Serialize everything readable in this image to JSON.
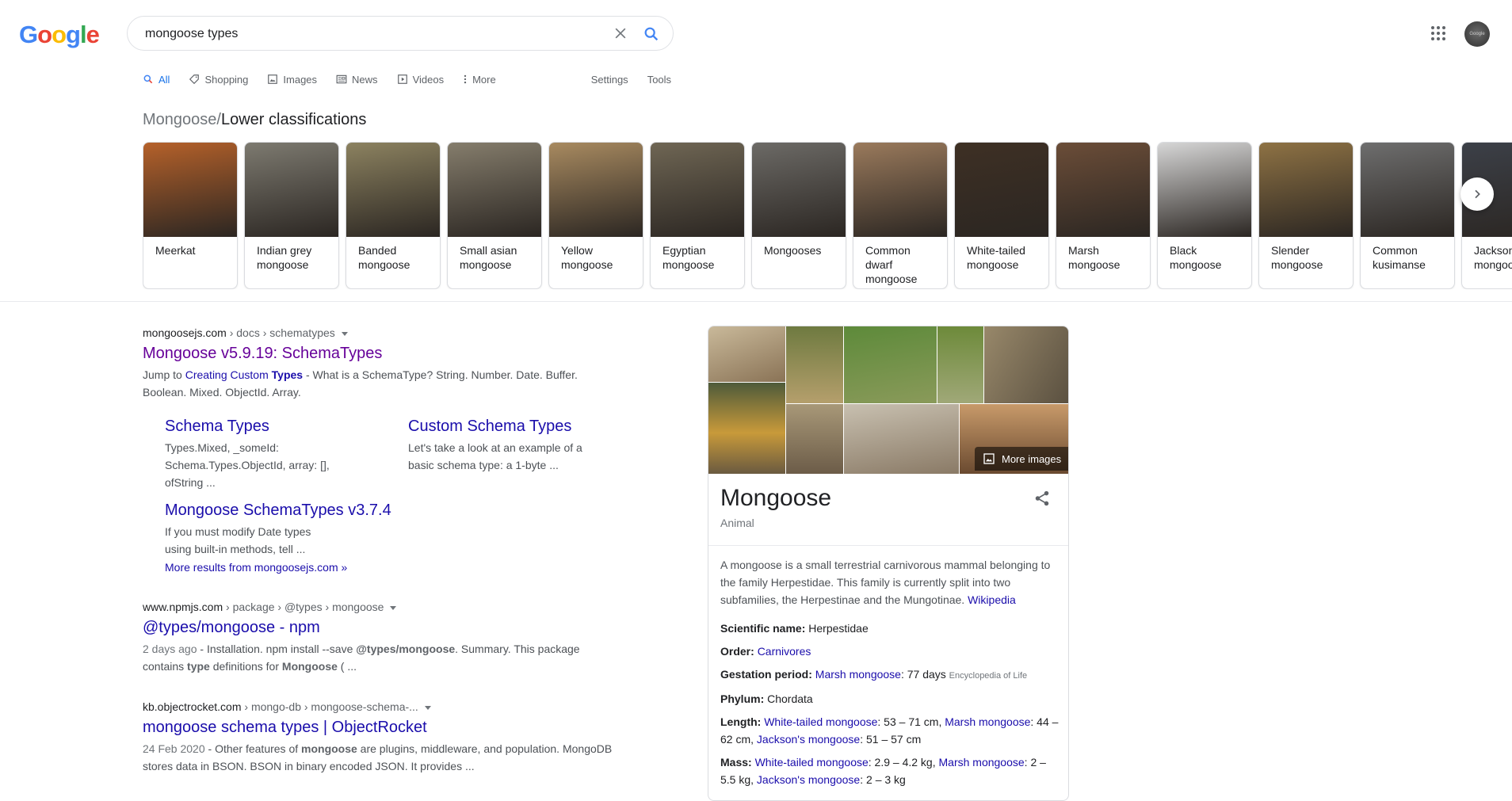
{
  "header": {
    "logo_text": "Google",
    "search_value": "mongoose types",
    "avatar_text": "Google"
  },
  "tabs": [
    {
      "label": "All",
      "icon": "search-icon",
      "active": true
    },
    {
      "label": "Shopping",
      "icon": "tag-icon"
    },
    {
      "label": "Images",
      "icon": "image-icon"
    },
    {
      "label": "News",
      "icon": "news-icon"
    },
    {
      "label": "Videos",
      "icon": "video-icon"
    },
    {
      "label": "More",
      "icon": "more-vert-icon"
    }
  ],
  "tools": {
    "settings": "Settings",
    "tools": "Tools"
  },
  "carousel": {
    "parent": "Mongoose",
    "separator": "/",
    "title": "Lower classifications",
    "items": [
      {
        "label": "Meerkat",
        "color": "#b5612a"
      },
      {
        "label": "Indian grey mongoose",
        "color": "#7d7a70"
      },
      {
        "label": "Banded mongoose",
        "color": "#8c8260"
      },
      {
        "label": "Small asian mongoose",
        "color": "#857d6c"
      },
      {
        "label": "Yellow mongoose",
        "color": "#a88a60"
      },
      {
        "label": "Egyptian mongoose",
        "color": "#6f6654"
      },
      {
        "label": "Mongooses",
        "color": "#6c6a66"
      },
      {
        "label": "Common dwarf mongoose",
        "color": "#9a7a5c"
      },
      {
        "label": "White-tailed mongoose",
        "color": "#3e3024"
      },
      {
        "label": "Marsh mongoose",
        "color": "#6b4d38"
      },
      {
        "label": "Black mongoose",
        "color": "#d6d6d6"
      },
      {
        "label": "Slender mongoose",
        "color": "#8e7244"
      },
      {
        "label": "Common kusimanse",
        "color": "#6e6e6e"
      },
      {
        "label": "Jackson's mongoose",
        "color": "#3c4048"
      }
    ]
  },
  "results": [
    {
      "domain": "mongoosejs.com",
      "path": " › docs › schematypes",
      "title": "Mongoose v5.9.19: SchemaTypes",
      "snippet_prefix": "Jump to ",
      "snippet_link_a": "Creating Custom ",
      "snippet_link_b": "Types",
      "snippet_rest": " - What is a SchemaType? String. Number. Date. Buffer. Boolean. Mixed. ObjectId. Array.",
      "sublinks": [
        {
          "title": "Schema Types",
          "snippet": "Types.Mixed, _someId: Schema.Types.ObjectId, array: [], ofString ..."
        },
        {
          "title": "Custom Schema Types",
          "snippet": "Let's take a look at an example of a basic schema type: a 1-byte ..."
        },
        {
          "title": "Mongoose SchemaTypes v3.7.4",
          "snippet": "If you must modify Date types using built-in methods, tell ..."
        }
      ],
      "more_results": "More results from mongoosejs.com »"
    },
    {
      "domain": "www.npmjs.com",
      "path": " › package › @types › mongoose",
      "title": "@types/mongoose - npm",
      "date": "2 days ago",
      "s1": " - Installation. npm install --save ",
      "b1": "@types/mongoose",
      "s2": ". Summary. This package contains ",
      "b2": "type",
      "s3": " definitions for ",
      "b3": "Mongoose",
      "s4": " ( ..."
    },
    {
      "domain": "kb.objectrocket.com",
      "path": " › mongo-db › mongoose-schema-...",
      "title": "mongoose schema types | ObjectRocket",
      "date": "24 Feb 2020",
      "s1": " - Other features of ",
      "b1": "mongoose",
      "s2": " are plugins, middleware, and population. MongoDB stores data in BSON. BSON in binary encoded JSON. It provides ..."
    }
  ],
  "knowledge_panel": {
    "more_images": "More images",
    "title": "Mongoose",
    "subtitle": "Animal",
    "description": "A mongoose is a small terrestrial carnivorous mammal belonging to the family Herpestidae. This family is currently split into two subfamilies, the Herpestinae and the Mungotinae. ",
    "description_link": "Wikipedia",
    "facts": {
      "sci_label": "Scientific name:",
      "sci_value": " Herpestidae",
      "order_label": "Order:",
      "order_link": "Carnivores",
      "gest_label": "Gestation period:",
      "gest_link": "Marsh mongoose",
      "gest_value": ": 77 days ",
      "gest_source": "Encyclopedia of Life",
      "phylum_label": "Phylum:",
      "phylum_value": " Chordata",
      "length_label": "Length:",
      "length_l1": "White-tailed mongoose",
      "length_v1": ": 53 – 71 cm, ",
      "length_l2": "Marsh mongoose",
      "length_v2": ": 44 – 62 cm, ",
      "length_l3": "Jackson's mongoose",
      "length_v3": ": 51 – 57 cm",
      "mass_label": "Mass:",
      "mass_l1": "White-tailed mongoose",
      "mass_v1": ": 2.9 – 4.2 kg, ",
      "mass_l2": "Marsh mongoose",
      "mass_v2": ": 2 – 5.5 kg, ",
      "mass_l3": "Jackson's mongoose",
      "mass_v3": ": 2 – 3 kg"
    }
  }
}
